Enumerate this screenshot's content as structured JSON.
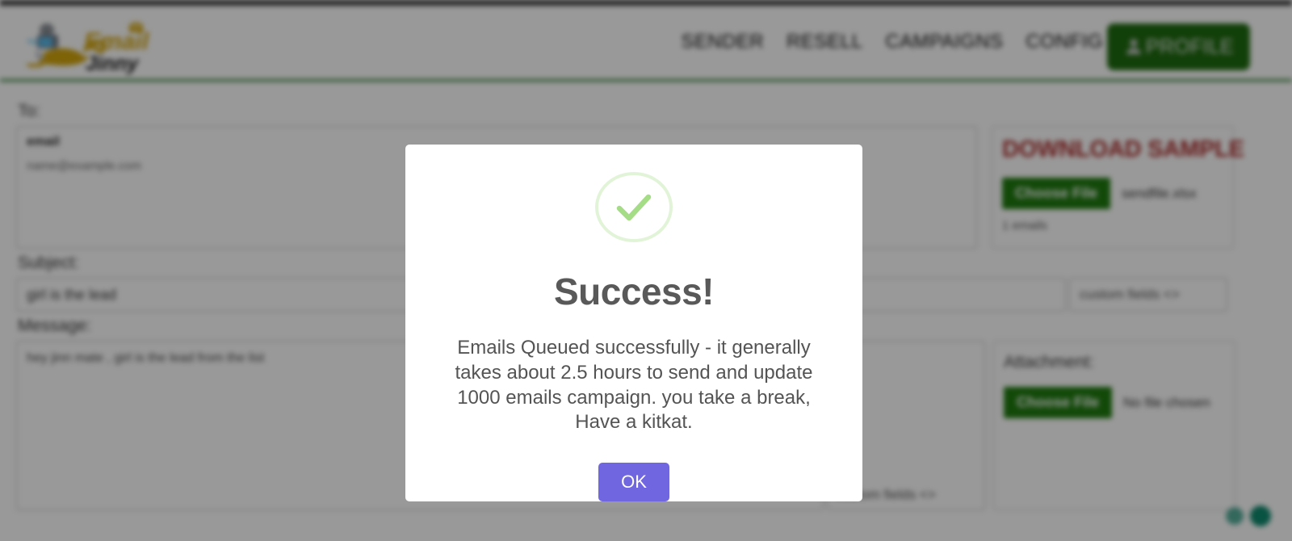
{
  "header": {
    "logo_main": "Email",
    "logo_sub": "Jinny",
    "nav_items": [
      {
        "label": "SENDER"
      },
      {
        "label": "RESELL"
      },
      {
        "label": "CAMPAIGNS"
      },
      {
        "label": "CONFIG"
      }
    ],
    "profile_label": "PROFILE",
    "profile_icon": "person-icon",
    "profile_color": "#1f6b10",
    "underline_color": "#2f7d32"
  },
  "form": {
    "to_label": "To:",
    "to_value_line1": "email",
    "to_value_line2": "name@example.com",
    "subject_label": "Subject:",
    "subject_value": "girl is the lead",
    "message_label": "Message:",
    "message_value": "hey jinn mate , girl is the lead from the list",
    "custom_fields_label": "custom fields <>",
    "custom_fields_label_2": "custom fields <>"
  },
  "sample_panel": {
    "title": "DOWNLOAD SAMPLE",
    "title_color": "#ab2b2b",
    "choose_file_label": "Choose File",
    "file_name": "sendfile.xlsx",
    "email_count": "1 emails"
  },
  "attachment_panel": {
    "title": "Attachment:",
    "choose_file_label": "Choose File",
    "file_name": "No file chosen"
  },
  "status_dots": {
    "dot_1": "status-dot-teal-light",
    "dot_2": "status-dot-teal-dark"
  },
  "modal": {
    "icon": "success-check-icon",
    "icon_color": "#a5dc86",
    "title": "Success!",
    "body": "Emails Queued successfully - it generally takes about 2.5 hours to send and update 1000 emails campaign. you take a break, Have a kitkat.",
    "ok_label": "OK",
    "ok_color": "#7066e0"
  }
}
